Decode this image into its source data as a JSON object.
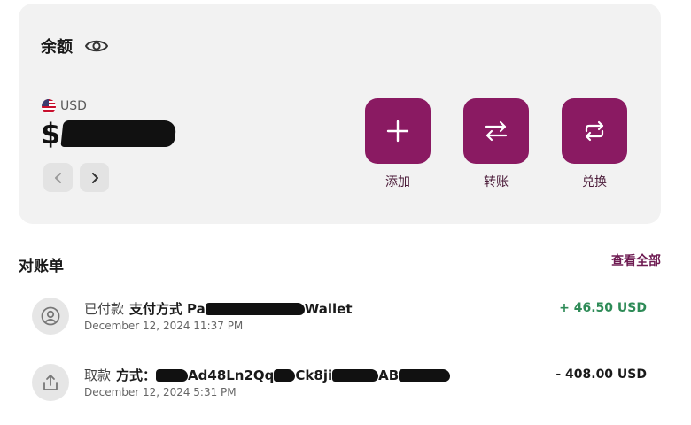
{
  "balance": {
    "title": "余额",
    "currency_code": "USD",
    "currency_symbol": "$"
  },
  "actions": [
    {
      "label": "添加",
      "icon": "plus-icon"
    },
    {
      "label": "转账",
      "icon": "transfer-arrows-icon"
    },
    {
      "label": "兑换",
      "icon": "exchange-cycle-icon"
    }
  ],
  "statement": {
    "title": "对账单",
    "view_all": "查看全部"
  },
  "transactions": [
    {
      "status": "已付款",
      "method_label": "支付方式",
      "method_prefix": "Pa",
      "method_suffix": "Wallet",
      "date": "December 12, 2024 11:37 PM",
      "amount": "+ 46.50 USD",
      "icon": "user-circle-icon"
    },
    {
      "status": "取款",
      "method_label": "方式：",
      "addr_part1": "Ad48Ln2Qq",
      "addr_part2": "Ck8ji",
      "addr_part3": "AB",
      "date": "December 12, 2024 5:31 PM",
      "amount": "- 408.00 USD",
      "icon": "upload-share-icon"
    }
  ],
  "colors": {
    "accent": "#8a1a62",
    "positive": "#2e8b57",
    "card_bg": "#f2f2f2"
  }
}
